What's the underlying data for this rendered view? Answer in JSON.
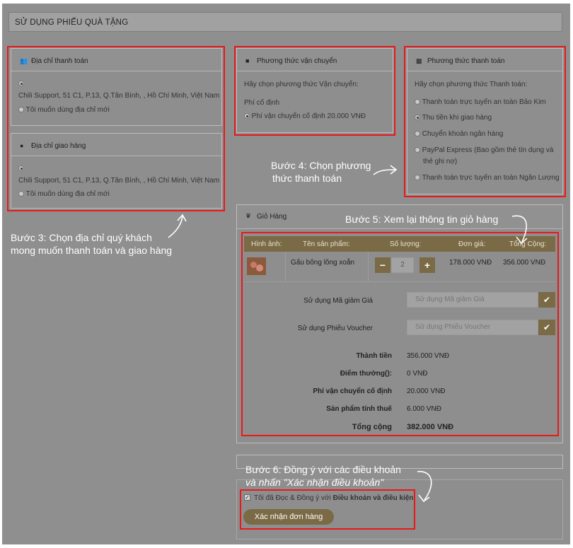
{
  "header": {
    "title": "SỬ DỤNG PHIẾU QUÀ TẶNG"
  },
  "billing": {
    "title": "Địa chỉ thanh toán",
    "address": "Chili Support, 51 C1, P.13, Q.Tân Bình, , Hồ Chí Minh, Việt Nam",
    "new_address": "Tôi muốn dùng địa chỉ mới"
  },
  "shipping_address": {
    "title": "Địa chỉ giao hàng",
    "address": "Chili Support, 51 C1, P.13, Q.Tân Bình, , Hồ Chí Minh, Việt Nam",
    "new_address": "Tôi muốn dùng địa chỉ mới"
  },
  "shipping_method": {
    "title": "Phương thức vận chuyển",
    "prompt": "Hãy chọn phương thức Vận chuyển:",
    "group": "Phí cố định",
    "option": "Phí vận chuyển cố định 20.000 VNĐ"
  },
  "payment_method": {
    "title": "Phương thức thanh toán",
    "prompt": "Hãy chọn phương thức Thanh toán:",
    "options": [
      "Thanh toán trực tuyến an toàn Bảo Kim",
      "Thu tiền khi giao hàng",
      "Chuyển khoản ngân hàng",
      "PayPal Express (Bao gồm thẻ tín dụng và",
      "thẻ ghi nợ)",
      "Thanh toán trực tuyến an toàn Ngân Lượng"
    ]
  },
  "cart": {
    "title": "Giỏ Hàng",
    "columns": [
      "Hình ảnh:",
      "Tên sản phẩm:",
      "Số lượng:",
      "Đơn giá:",
      "Tổng Cộng:"
    ],
    "item": {
      "name": "Gấu bông lông xoắn",
      "qty": "2",
      "minus": "−",
      "plus": "+",
      "price": "178.000 VNĐ",
      "total": "356.000 VNĐ"
    },
    "coupon_label": "Sử dụng Mã giảm Giá",
    "coupon_placeholder": "Sử dụng Mã giảm Giá",
    "voucher_label": "Sử dụng Phiếu Voucher",
    "voucher_placeholder": "Sử dụng Phiếu Voucher",
    "apply_glyph": "✔",
    "totals": [
      {
        "label": "Thành tiền",
        "value": "356.000 VNĐ"
      },
      {
        "label": "Điểm thưởng():",
        "value": "0 VNĐ"
      },
      {
        "label": "Phí vận chuyển cố định",
        "value": "20.000 VNĐ"
      },
      {
        "label": "Sản phẩm tính thuế",
        "value": "6.000 VNĐ"
      },
      {
        "label": "Tổng cộng",
        "value": "382.000 VNĐ"
      }
    ]
  },
  "agree": {
    "prefix": "Tôi đã Đọc & Đồng ý với ",
    "link": "Điều khoản và điều kiện",
    "confirm_button": "Xác nhận đơn hàng"
  },
  "notes": {
    "step3_line1": "Bước 3: Chọn địa chỉ quý khách",
    "step3_line2": "mong muốn thanh toán và giao hàng",
    "step4_line1": "Bước 4: Chọn phương",
    "step4_line2": "thức thanh toán",
    "step5": "Bước 5: Xem lại thông tin giỏ hàng",
    "step6_line1": "Bước 6: Đồng ý với các điều khoản",
    "step6_line2": "và nhấn \"Xác nhận điều khoản\""
  },
  "icons": {
    "billing": "users-icon",
    "shipping_address": "map-pin-icon",
    "shipping_method": "truck-icon",
    "payment_method": "credit-card-icon",
    "cart": "crown-icon"
  },
  "colors": {
    "highlight": "#e8191b",
    "accent": "#7a6a45",
    "overlay": "#8f8f8f"
  }
}
